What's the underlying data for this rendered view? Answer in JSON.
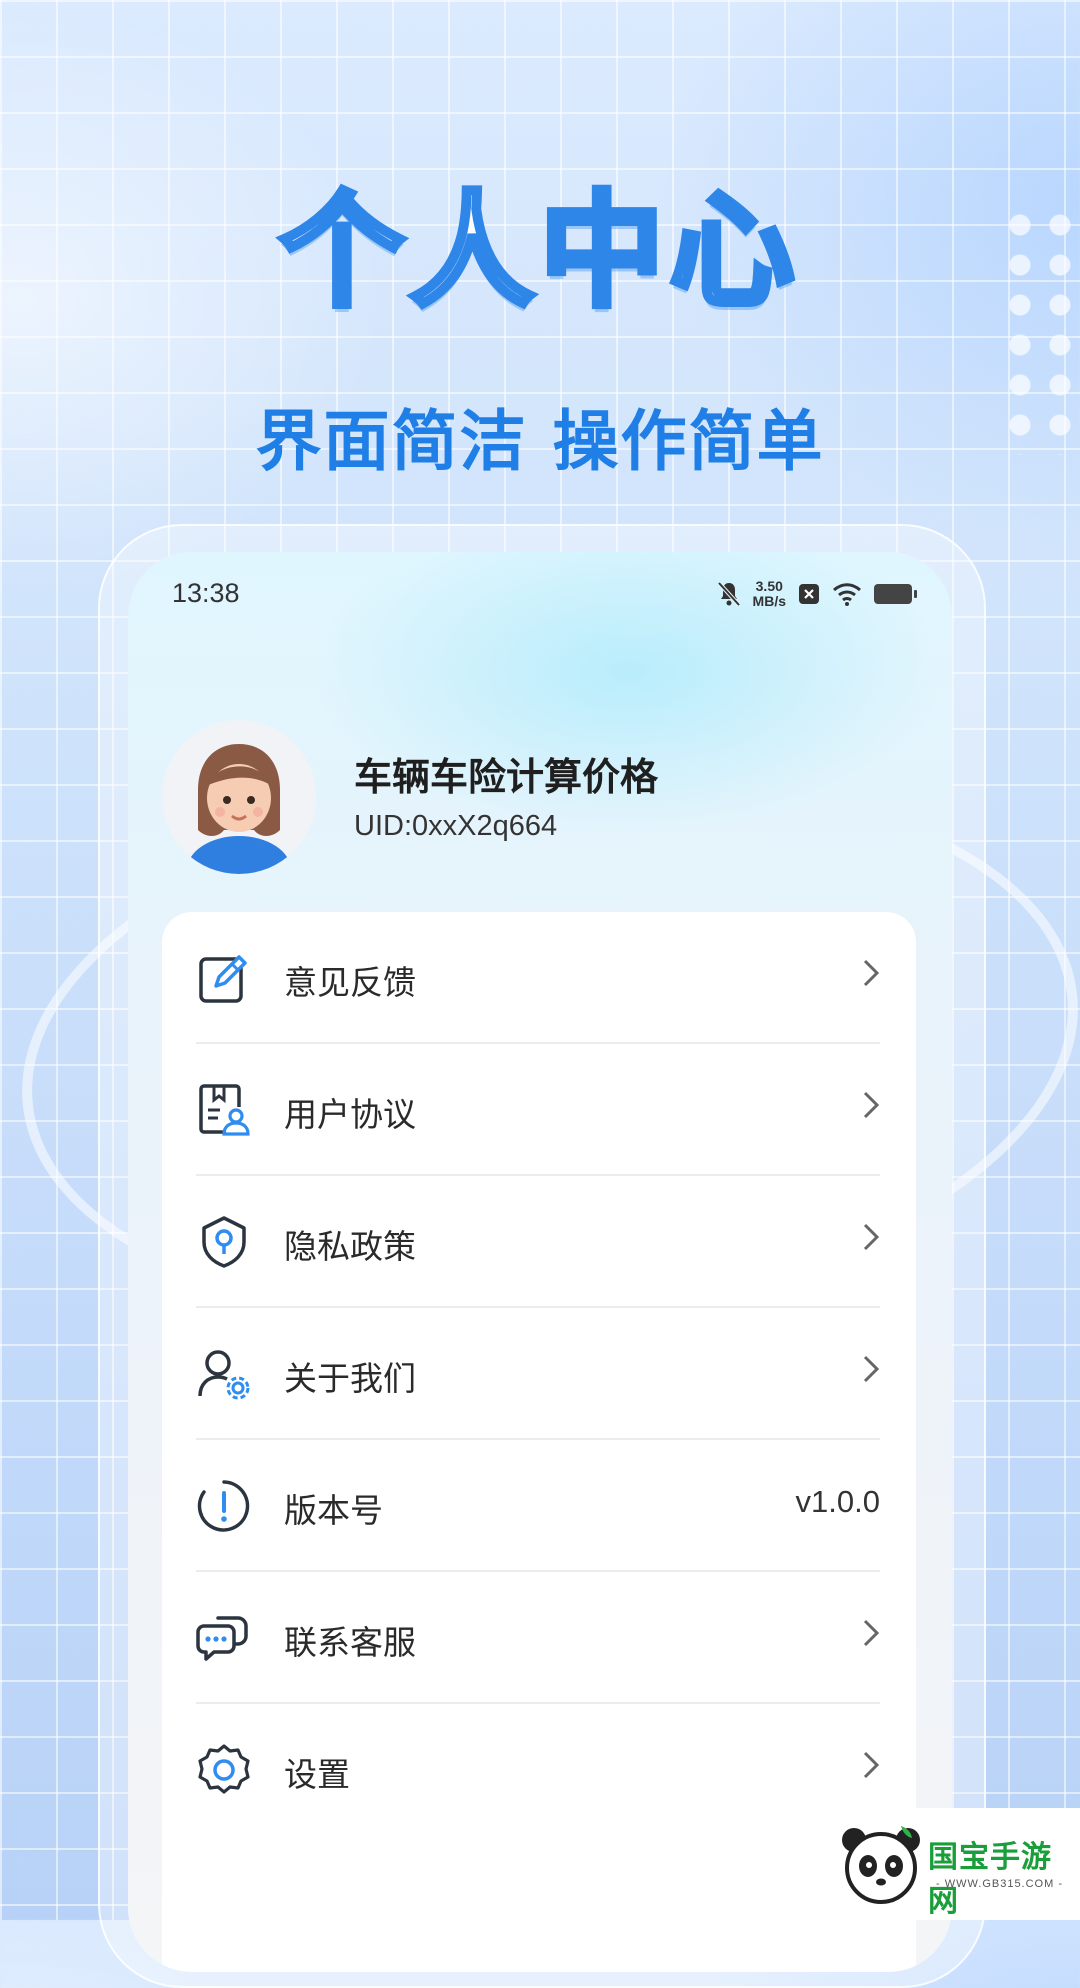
{
  "hero": {
    "title": "个人中心",
    "subtitle": "界面简洁 操作简单"
  },
  "status_bar": {
    "time": "13:38",
    "net_speed_value": "3.50",
    "net_speed_unit": "MB/s",
    "icons": [
      "mute-bell-icon",
      "close-box-icon",
      "wifi-icon",
      "battery-icon"
    ]
  },
  "profile": {
    "name": "车辆车险计算价格",
    "uid": "UID:0xxX2q664"
  },
  "menu": {
    "items": [
      {
        "label": "意见反馈",
        "icon": "feedback-edit-icon"
      },
      {
        "label": "用户协议",
        "icon": "user-agreement-icon"
      },
      {
        "label": "隐私政策",
        "icon": "privacy-shield-icon"
      },
      {
        "label": "关于我们",
        "icon": "about-us-icon"
      },
      {
        "label": "版本号",
        "icon": "info-exclamation-icon",
        "value": "v1.0.0"
      },
      {
        "label": "联系客服",
        "icon": "chat-bubble-icon"
      },
      {
        "label": "设置",
        "icon": "settings-gear-icon"
      }
    ]
  },
  "watermark": {
    "brand": "国宝手游网",
    "site": "- WWW.GB315.COM -"
  },
  "colors": {
    "accent": "#2e86e8",
    "subtitle": "#1f7fe6",
    "icon_blue": "#2f8cf0",
    "icon_dark": "#2c3440"
  }
}
